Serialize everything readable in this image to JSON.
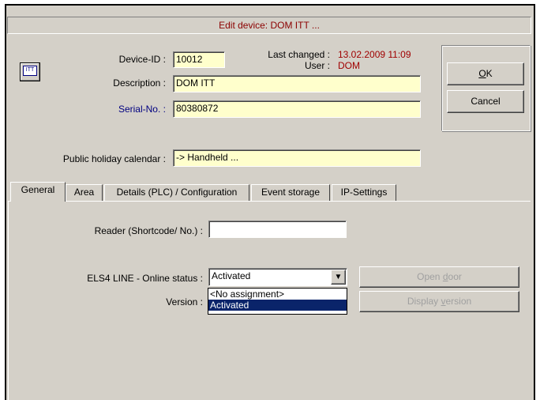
{
  "window": {
    "title": "Edit device: DOM ITT ..."
  },
  "device": {
    "icon_text": "ITT",
    "device_id_label": "Device-ID :",
    "device_id_value": "10012",
    "description_label": "Description :",
    "description_value": "DOM ITT",
    "serial_label": "Serial-No. :",
    "serial_value": "80380872",
    "last_changed_label": "Last changed :",
    "last_changed_value": "13.02.2009 11:09",
    "user_label": "User :",
    "user_value": "DOM",
    "holiday_label": "Public holiday calendar :",
    "holiday_value": "-> Handheld ..."
  },
  "buttons": {
    "ok_prefix": "",
    "ok_hotkey": "O",
    "ok_rest": "K",
    "cancel": "Cancel"
  },
  "tabs": [
    {
      "label": "General"
    },
    {
      "label": "Area"
    },
    {
      "label": "Details (PLC) / Configuration"
    },
    {
      "label": "Event storage"
    },
    {
      "label": "IP-Settings"
    }
  ],
  "general": {
    "reader_label": "Reader (Shortcode/ No.) :",
    "reader_value": "",
    "online_label": "ELS4 LINE - Online status :",
    "online_value": "Activated",
    "version_label": "Version :",
    "dropdown_options": [
      "<No assignment>",
      "Activated"
    ],
    "open_door_prefix": "Open ",
    "open_door_hotkey": "d",
    "open_door_rest": "oor",
    "display_version_prefix": "Display ",
    "display_version_hotkey": "v",
    "display_version_rest": "ersion"
  },
  "colors": {
    "face": "#d4d0c8",
    "field_yellow": "#ffffcc",
    "selection": "#0a246a",
    "title_text": "#8b0000",
    "changed_text": "#a00000",
    "serial_label": "#000080"
  }
}
